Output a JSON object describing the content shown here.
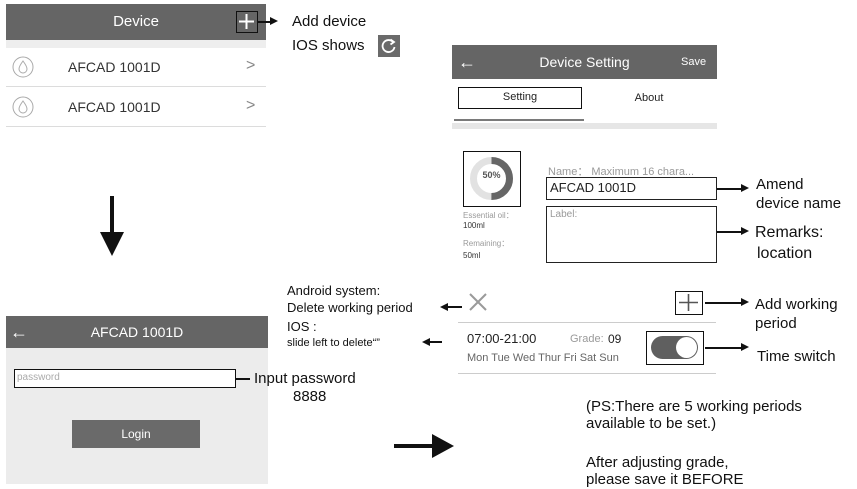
{
  "device_list": {
    "title": "Device",
    "items": [
      {
        "name": "AFCAD 1001D"
      },
      {
        "name": "AFCAD 1001D"
      }
    ]
  },
  "login": {
    "title": "AFCAD 1001D",
    "password_placeholder": "password",
    "login_button": "Login"
  },
  "device_setting": {
    "title": "Device Setting",
    "save_label": "Save",
    "tabs": [
      "Setting",
      "About"
    ],
    "gauge_percent": 50,
    "gauge_label": "50%",
    "essential_oil_label": "Essential oil：",
    "essential_oil_value": "100ml",
    "remaining_label": "Remaining：",
    "remaining_value": "50ml",
    "name_hint": "Name： Maximum 16 chara...",
    "name_value": "AFCAD 1001D",
    "label_placeholder": "Label:",
    "period_time": "07:00-21:00",
    "grade_label": "Grade:",
    "grade_value": "09",
    "period_days": "Mon Tue Wed Thur Fri Sat Sun",
    "time_switch_on": true
  },
  "annotations": {
    "add_device": "Add device",
    "ios_shows": "IOS shows",
    "input_password": "Input password",
    "password_value": "8888",
    "android_system": "Android system:",
    "delete_working_period": "Delete working period",
    "ios_colon": "IOS :",
    "slide_left": "slide left to delete“”",
    "amend_1": "Amend",
    "amend_2": "device name",
    "remarks_1": "Remarks:",
    "remarks_2": "location",
    "add_period_1": "Add working",
    "add_period_2": "period",
    "time_switch": "Time switch",
    "ps_1": "(PS:There are 5 working periods",
    "ps_2": "available to be set.)",
    "after_1": "After adjusting grade,",
    "after_2": "please save it BEFORE"
  },
  "colors": {
    "header": "#656565",
    "toggle": "#5f5f5f",
    "gauge": "#666666"
  }
}
